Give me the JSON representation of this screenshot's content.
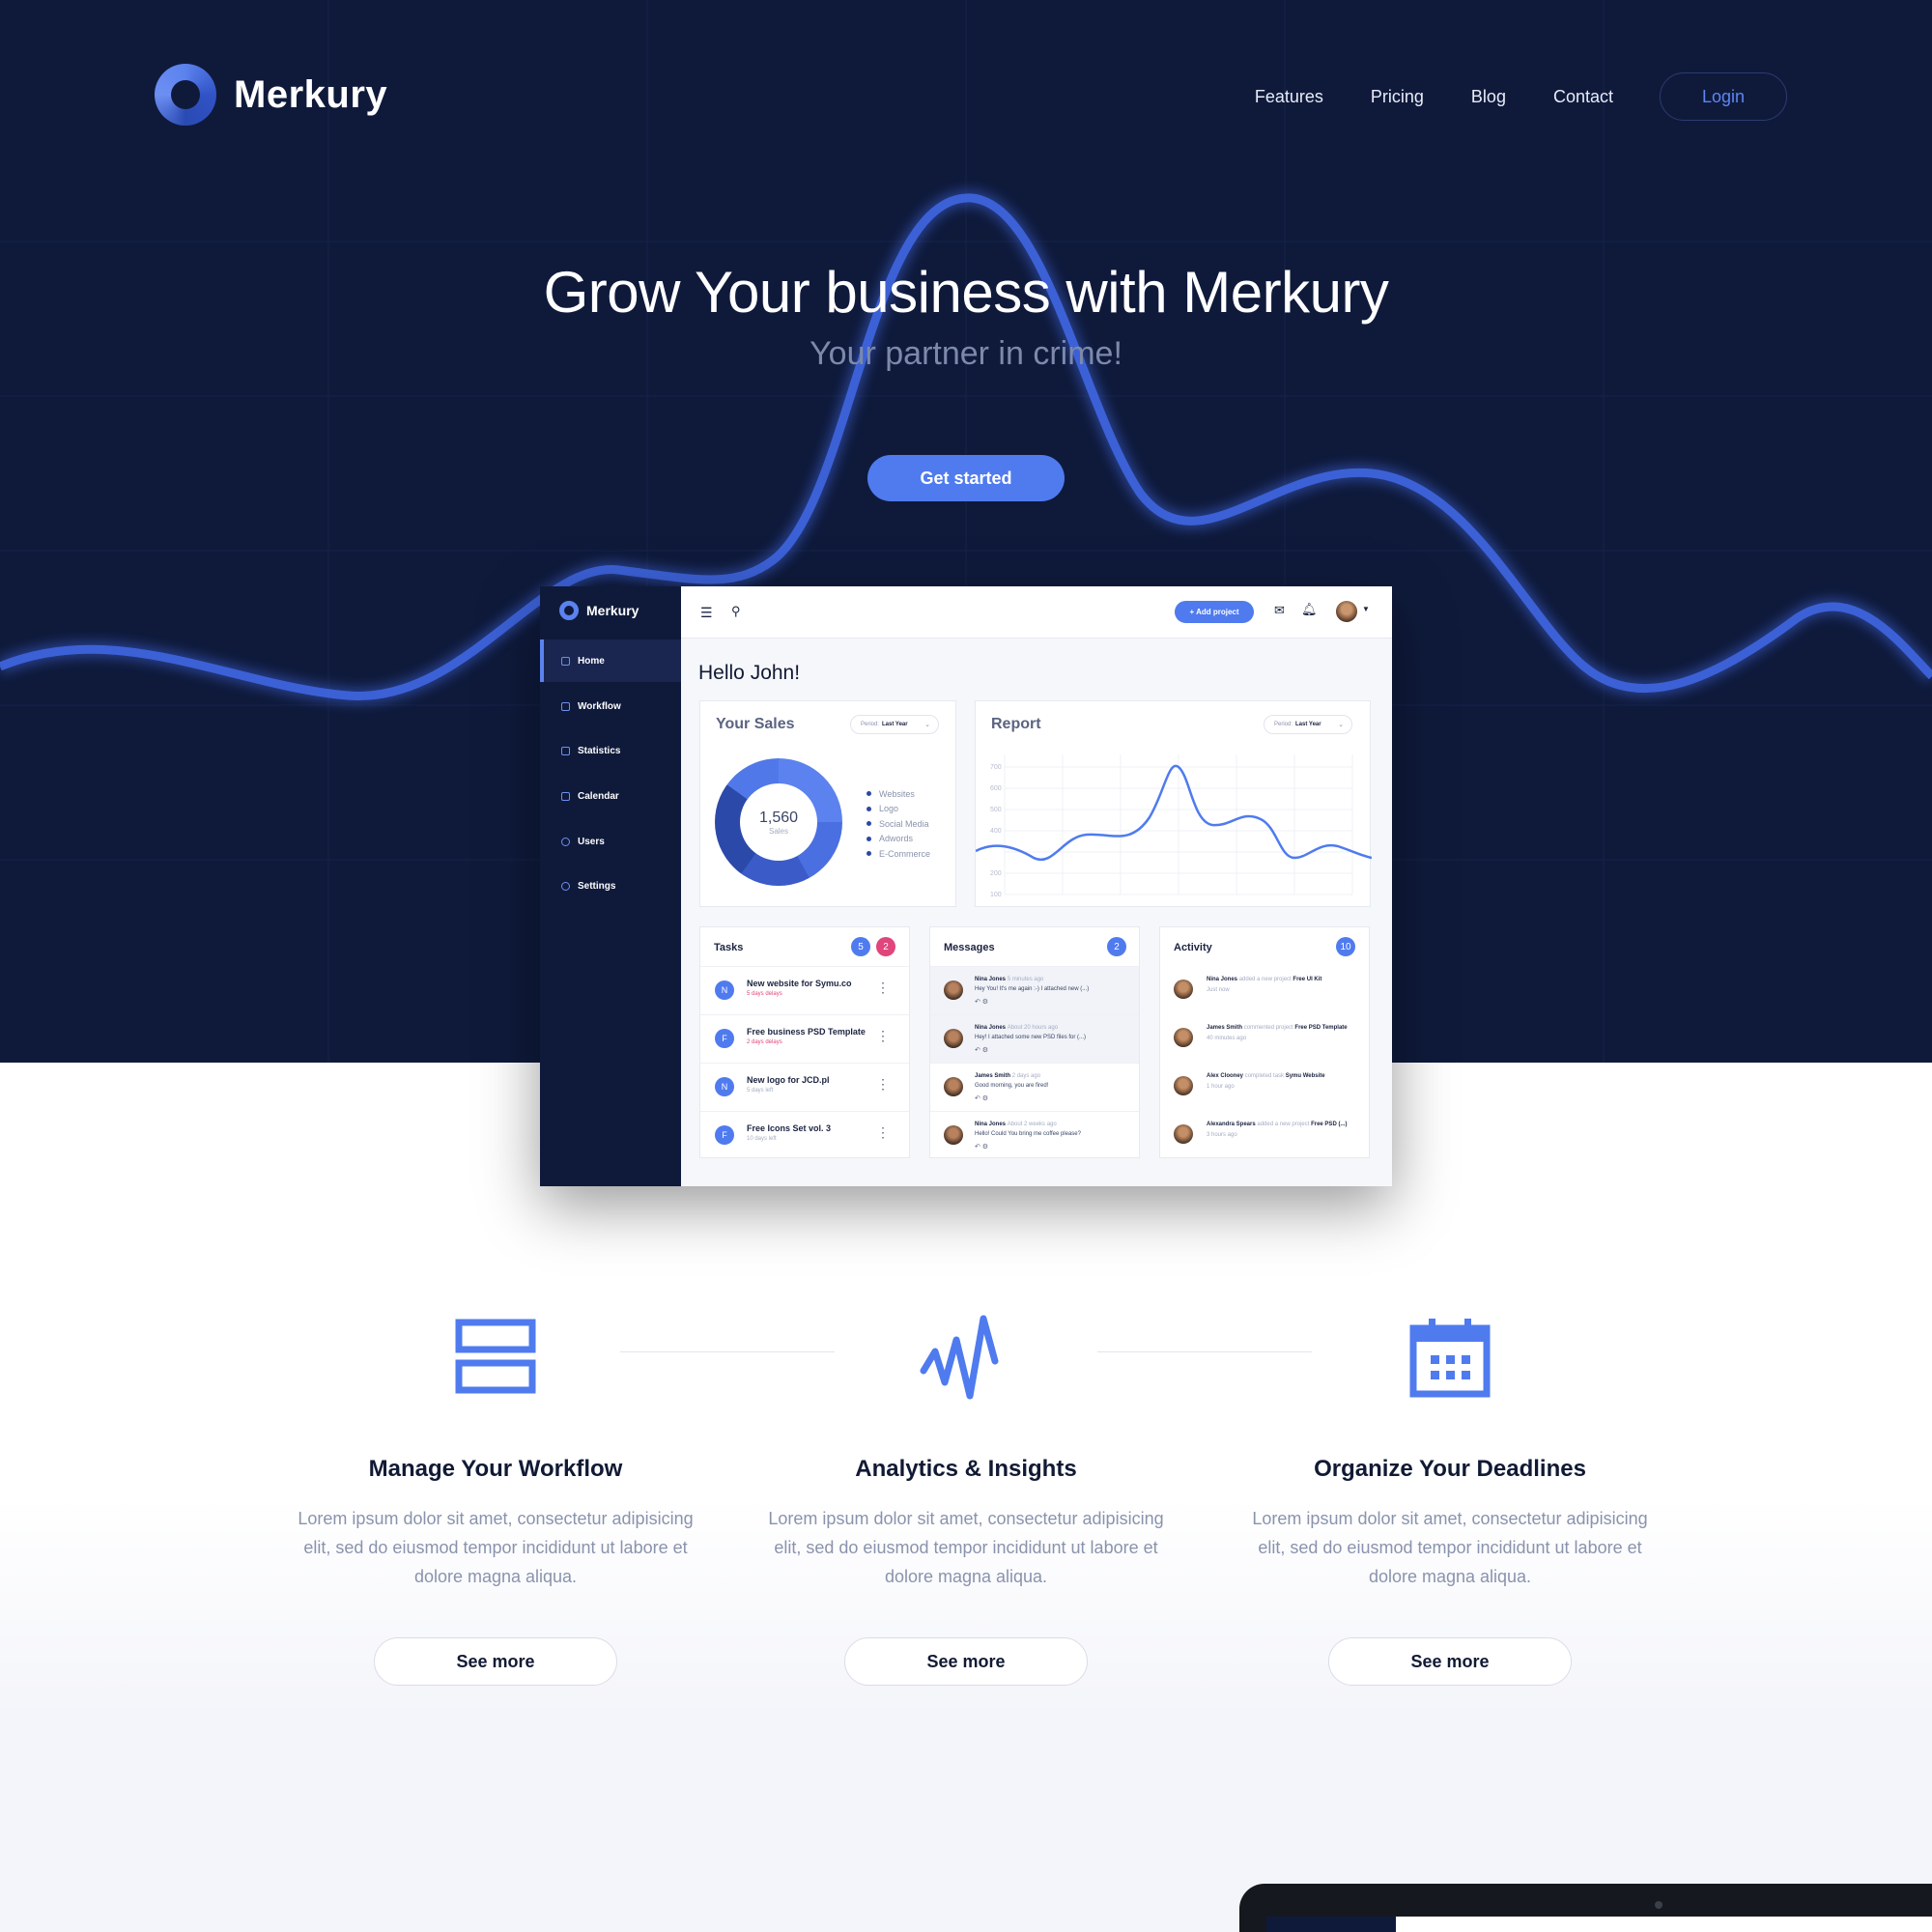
{
  "colors": {
    "hero_bg": "#0f1a3b",
    "accent": "#4f7bef",
    "text_dark": "#111a34",
    "text_muted": "#8a93ad"
  },
  "brand": {
    "name": "Merkury",
    "logo_icon": "ring-logo-icon"
  },
  "nav": {
    "items": [
      "Features",
      "Pricing",
      "Blog",
      "Contact"
    ],
    "login": "Login"
  },
  "hero": {
    "title": "Grow Your business with Merkury",
    "subtitle": "Your partner in crime!",
    "cta": "Get started"
  },
  "dashboard": {
    "brand": "Merkury",
    "sidebar": [
      {
        "label": "Home",
        "icon": "home-icon",
        "active": true
      },
      {
        "label": "Workflow",
        "icon": "workflow-icon",
        "active": false
      },
      {
        "label": "Statistics",
        "icon": "statistics-icon",
        "active": false
      },
      {
        "label": "Calendar",
        "icon": "calendar-icon",
        "active": false
      },
      {
        "label": "Users",
        "icon": "user-icon",
        "active": false
      },
      {
        "label": "Settings",
        "icon": "settings-icon",
        "active": false
      }
    ],
    "topbar": {
      "add_project": "+ Add project",
      "notifications_dot": true
    },
    "greeting": "Hello John!",
    "sales": {
      "title": "Your Sales",
      "period_label": "Period:",
      "period_value": "Last Year",
      "total": "1,560",
      "total_label": "Sales",
      "legend": [
        "Websites",
        "Logo",
        "Social Media",
        "Adwords",
        "E-Commerce"
      ]
    },
    "report": {
      "title": "Report",
      "period_label": "Period:",
      "period_value": "Last Year",
      "y_ticks": [
        "700",
        "600",
        "500",
        "400",
        "200",
        "100"
      ]
    },
    "tasks": {
      "title": "Tasks",
      "badges": [
        "5",
        "2"
      ],
      "items": [
        {
          "initial": "N",
          "title": "New website for Symu.co",
          "due": "5 days delays",
          "late": true
        },
        {
          "initial": "F",
          "title": "Free business PSD Template",
          "due": "2 days delays",
          "late": true
        },
        {
          "initial": "N",
          "title": "New logo for JCD.pl",
          "due": "5 days left",
          "late": false
        },
        {
          "initial": "F",
          "title": "Free Icons Set vol. 3",
          "due": "10 days left",
          "late": false
        }
      ]
    },
    "messages": {
      "title": "Messages",
      "badge": "2",
      "items": [
        {
          "name": "Nina Jones",
          "time": "5 minutes ago",
          "text": "Hey You! It's me again :-) I attached new (...)"
        },
        {
          "name": "Nina Jones",
          "time": "About 20 hours ago",
          "text": "Hey! I attached some new PSD files for (...)"
        },
        {
          "name": "James Smith",
          "time": "2 days ago",
          "text": "Good morning, you are fired!"
        },
        {
          "name": "Nina Jones",
          "time": "About 2 weeks ago",
          "text": "Hello! Could You bring me coffee please?"
        }
      ]
    },
    "activity": {
      "title": "Activity",
      "badge": "10",
      "items": [
        {
          "name": "Nina Jones",
          "action": "added a new project",
          "target": "Free UI Kit",
          "time": "Just now"
        },
        {
          "name": "James Smith",
          "action": "commented project",
          "target": "Free PSD Template",
          "time": "40 minutes ago"
        },
        {
          "name": "Alex Clooney",
          "action": "completed task",
          "target": "Symu Website",
          "time": "1 hour ago"
        },
        {
          "name": "Alexandra Spears",
          "action": "added a new project",
          "target": "Free PSD (...)",
          "time": "3 hours ago"
        }
      ]
    }
  },
  "features": [
    {
      "icon": "workflow-icon",
      "title": "Manage Your Workflow",
      "text": "Lorem ipsum dolor sit amet, consectetur adipisicing elit, sed do eiusmod tempor incididunt ut labore et dolore magna aliqua.",
      "button": "See more"
    },
    {
      "icon": "analytics-pulse-icon",
      "title": "Analytics & Insights",
      "text": "Lorem ipsum dolor sit amet, consectetur adipisicing elit, sed do eiusmod tempor incididunt ut labore et dolore magna aliqua.",
      "button": "See more"
    },
    {
      "icon": "calendar-icon",
      "title": "Organize Your Deadlines",
      "text": "Lorem ipsum dolor sit amet, consectetur adipisicing elit, sed do eiusmod tempor incididunt ut labore et dolore magna aliqua.",
      "button": "See more"
    }
  ]
}
